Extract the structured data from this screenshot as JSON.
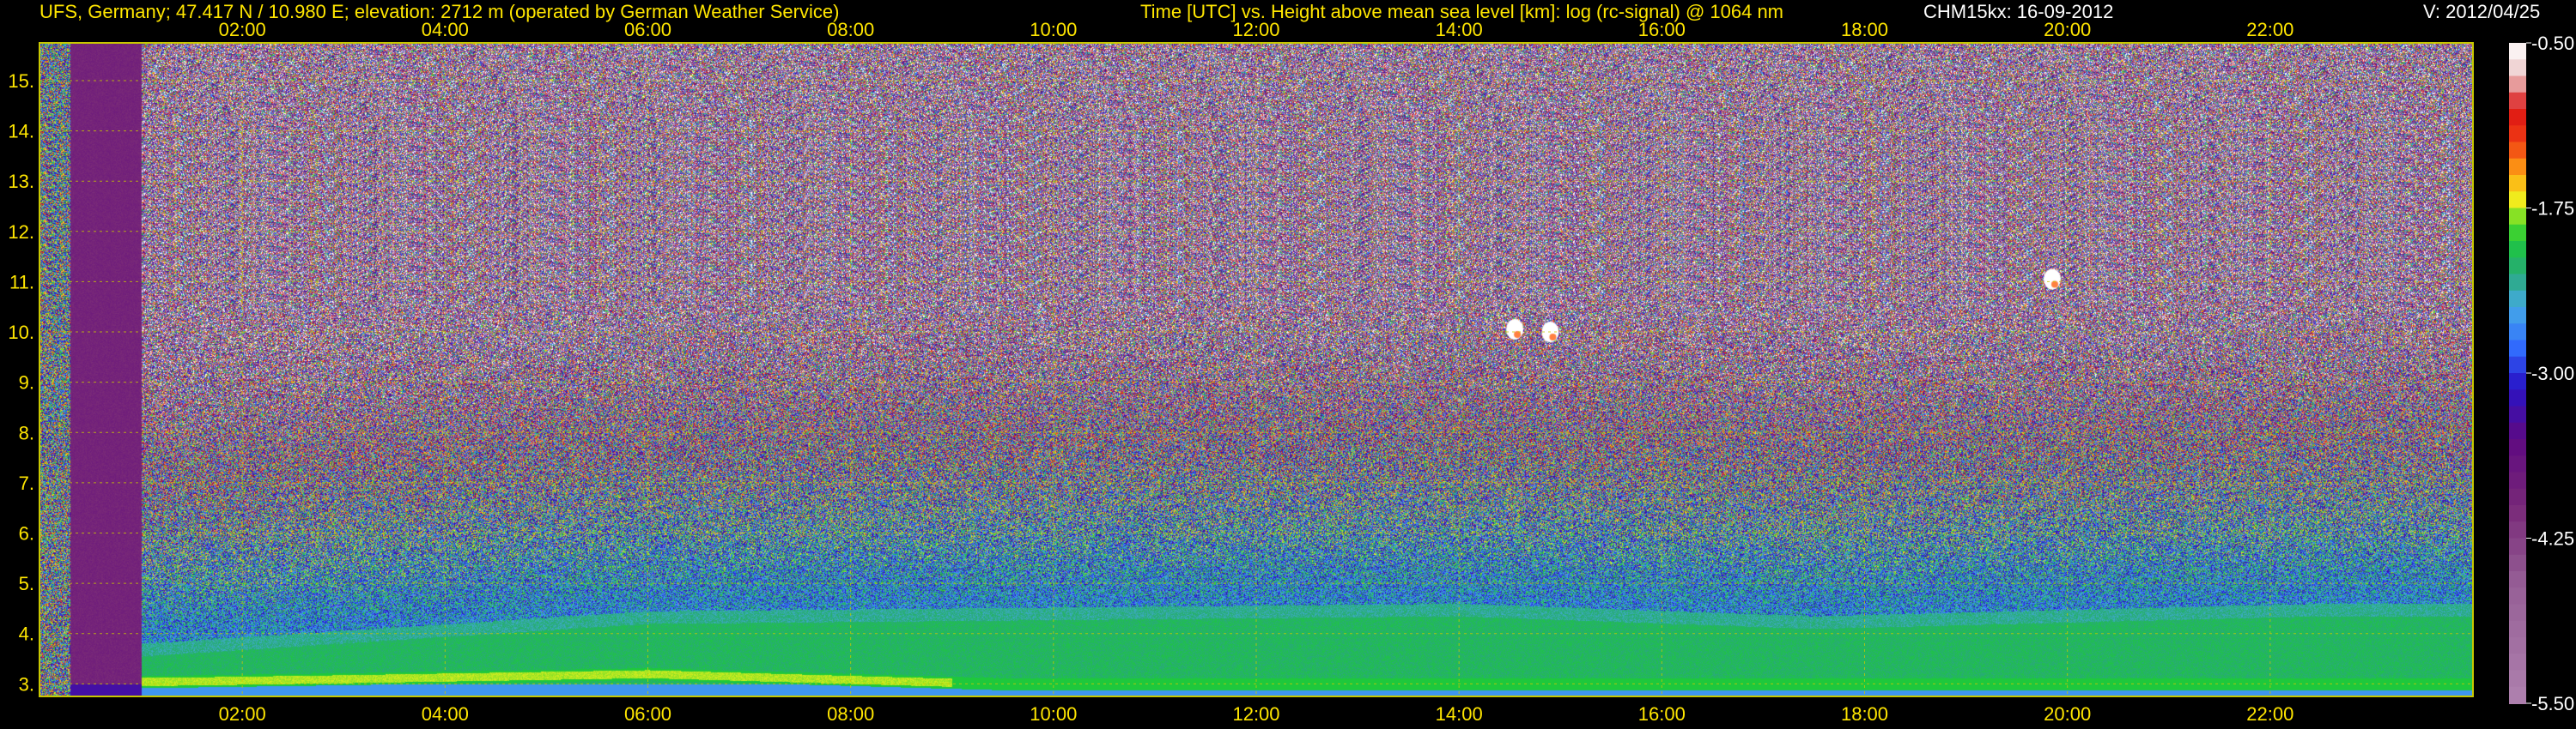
{
  "header": {
    "station": "UFS, Germany; 47.417 N / 10.980 E; elevation: 2712 m  (operated by German Weather Service)",
    "axes_title": "Time [UTC] vs. Height above mean sea level [km]: log (rc-signal) @ 1064 nm",
    "instrument_date": "CHM15kx: 16-09-2012",
    "version": "V: 2012/04/25"
  },
  "colors": {
    "axis_text": "#ffe600",
    "grid": "#c8c800",
    "background": "#000000"
  },
  "chart_data": {
    "type": "heatmap",
    "title": "Time [UTC] vs. Height above mean sea level [km]: log (rc-signal) @ 1064 nm",
    "xlabel": "Time [UTC]",
    "ylabel": "Height above mean sea level [km]",
    "x_ticks": [
      "02:00",
      "04:00",
      "06:00",
      "08:00",
      "10:00",
      "12:00",
      "14:00",
      "16:00",
      "18:00",
      "20:00",
      "22:00"
    ],
    "x_tick_hours": [
      2,
      4,
      6,
      8,
      10,
      12,
      14,
      16,
      18,
      20,
      22
    ],
    "xlim_hours": [
      0,
      24
    ],
    "y_ticks": [
      "3.",
      "4.",
      "5.",
      "6.",
      "7.",
      "8.",
      "9.",
      "10.",
      "11.",
      "12.",
      "13.",
      "14.",
      "15."
    ],
    "y_tick_values": [
      3,
      4,
      5,
      6,
      7,
      8,
      9,
      10,
      11,
      12,
      13,
      14,
      15
    ],
    "ylim_km": [
      2.75,
      15.75
    ],
    "colorbar": {
      "ticks": [
        "-0.50",
        "-1.75",
        "-3.00",
        "-4.25",
        "-5.50"
      ],
      "tick_values": [
        -0.5,
        -1.75,
        -3.0,
        -4.25,
        -5.5
      ],
      "range": [
        -5.5,
        -0.5
      ]
    },
    "grid": true,
    "features": {
      "data_gap_hours": [
        0.3,
        1.0
      ],
      "boundary_layer_top_km": [
        {
          "t": 1.0,
          "h": 3.8
        },
        {
          "t": 6.0,
          "h": 4.45
        },
        {
          "t": 14.0,
          "h": 4.6
        },
        {
          "t": 17.5,
          "h": 4.35
        },
        {
          "t": 22.5,
          "h": 4.6
        }
      ],
      "aerosol_layer_km": [
        {
          "t": 1.3,
          "h": 3.05
        },
        {
          "t": 3.0,
          "h": 3.1
        },
        {
          "t": 6.0,
          "h": 3.2
        },
        {
          "t": 9.5,
          "h": 3.0
        },
        {
          "t": 23.8,
          "h": 3.0
        }
      ],
      "clouds": [
        {
          "t": 14.55,
          "h": 10.05
        },
        {
          "t": 14.9,
          "h": 10.0
        },
        {
          "t": 19.85,
          "h": 11.05
        }
      ]
    }
  }
}
